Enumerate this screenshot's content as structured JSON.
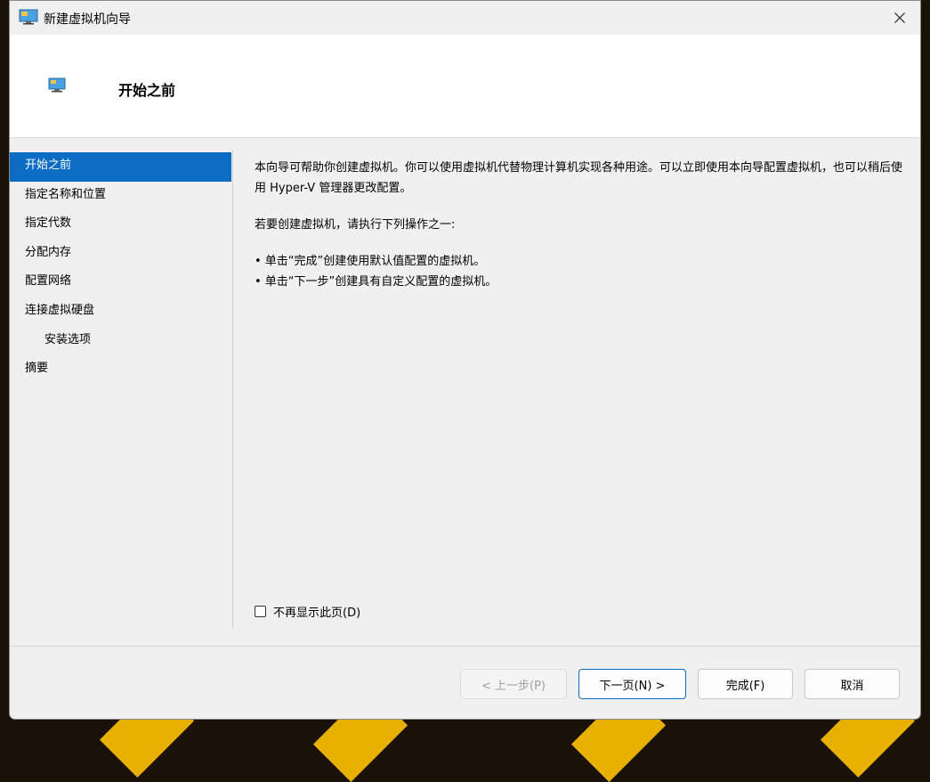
{
  "window": {
    "title": "新建虚拟机向导"
  },
  "header": {
    "title": "开始之前"
  },
  "nav": {
    "items": [
      {
        "label": "开始之前"
      },
      {
        "label": "指定名称和位置"
      },
      {
        "label": "指定代数"
      },
      {
        "label": "分配内存"
      },
      {
        "label": "配置网络"
      },
      {
        "label": "连接虚拟硬盘"
      },
      {
        "label": "安装选项"
      },
      {
        "label": "摘要"
      }
    ]
  },
  "content": {
    "intro": "本向导可帮助你创建虚拟机。你可以使用虚拟机代替物理计算机实现各种用途。可以立即使用本向导配置虚拟机，也可以稍后使用 Hyper-V 管理器更改配置。",
    "instruction": "若要创建虚拟机，请执行下列操作之一:",
    "bullets": [
      "• 单击“完成”创建使用默认值配置的虚拟机。",
      "• 单击“下一步”创建具有自定义配置的虚拟机。"
    ]
  },
  "checkbox": {
    "label": "不再显示此页(D)",
    "checked": false
  },
  "buttons": {
    "prev": "< 上一步(P)",
    "next": "下一页(N) >",
    "finish": "完成(F)",
    "cancel": "取消"
  },
  "colors": {
    "accent": "#0a6cc2",
    "window_bg": "#f0f0f0"
  }
}
